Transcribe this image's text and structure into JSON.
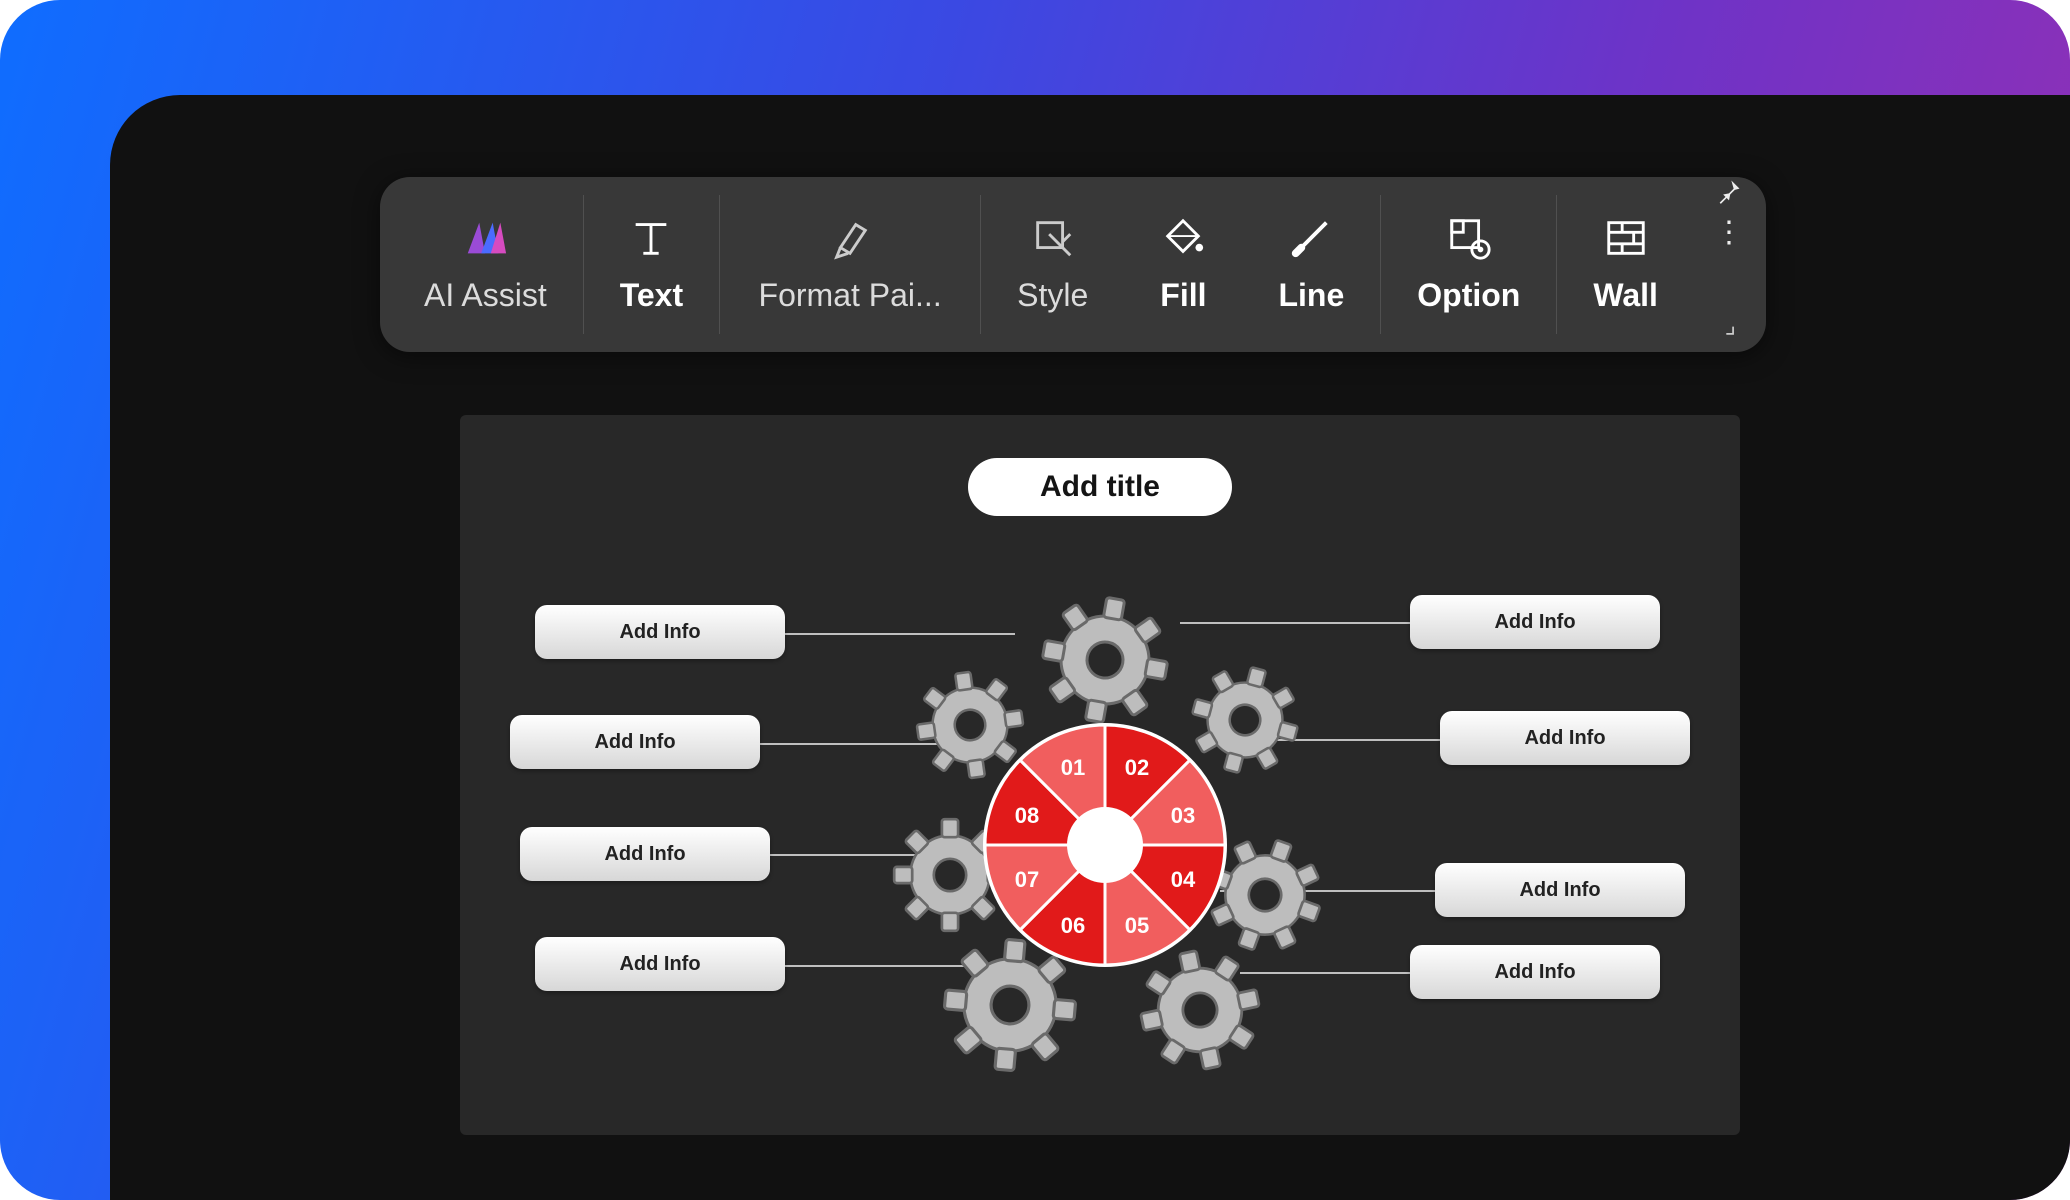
{
  "toolbar": {
    "ai_assist": "AI Assist",
    "text": "Text",
    "format_painter": "Format Pai...",
    "style": "Style",
    "fill": "Fill",
    "line": "Line",
    "option": "Option",
    "wall": "Wall"
  },
  "slide": {
    "title": "Add title",
    "segments": [
      "01",
      "02",
      "03",
      "04",
      "05",
      "06",
      "07",
      "08"
    ],
    "info_left": [
      "Add Info",
      "Add Info",
      "Add Info",
      "Add Info"
    ],
    "info_right": [
      "Add Info",
      "Add Info",
      "Add Info",
      "Add Info"
    ]
  },
  "colors": {
    "seg_dark": "#e11a1a",
    "seg_light": "#f15e5e",
    "hub": "#ffffff",
    "gear": "#bcbcbc",
    "gear_stroke": "#6a6a6a"
  }
}
